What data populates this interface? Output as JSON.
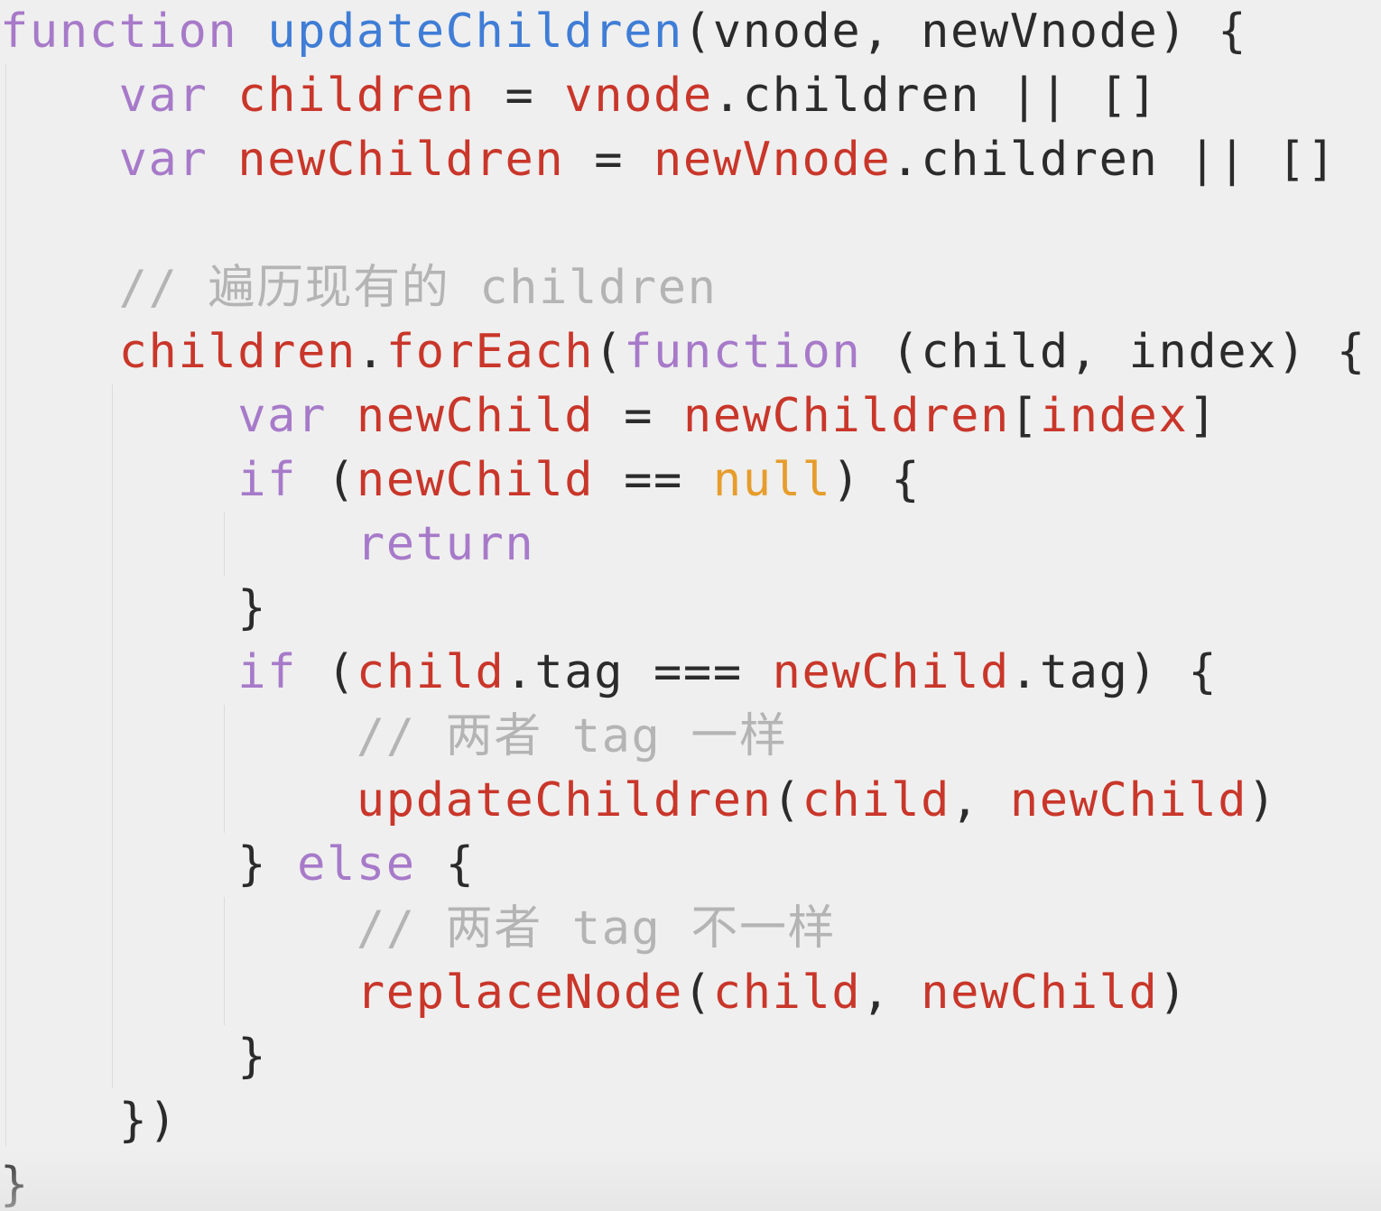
{
  "colors": {
    "keyword": "#a77ac9",
    "function_name": "#3f7dd6",
    "variable": "#c9362a",
    "plain": "#2b2b2b",
    "comment": "#b4b4b4",
    "literal": "#e69d2c",
    "background": "#efefef"
  },
  "code": {
    "lines": [
      {
        "tokens": [
          {
            "text": "function",
            "kind": "keyword"
          },
          {
            "text": " ",
            "kind": "plain"
          },
          {
            "text": "updateChildren",
            "kind": "function_name"
          },
          {
            "text": "(vnode, newVnode) {",
            "kind": "plain"
          }
        ]
      },
      {
        "tokens": [
          {
            "text": "    ",
            "kind": "plain"
          },
          {
            "text": "var",
            "kind": "keyword"
          },
          {
            "text": " ",
            "kind": "plain"
          },
          {
            "text": "children",
            "kind": "variable"
          },
          {
            "text": " = ",
            "kind": "plain"
          },
          {
            "text": "vnode",
            "kind": "variable"
          },
          {
            "text": ".children || []",
            "kind": "plain"
          }
        ]
      },
      {
        "tokens": [
          {
            "text": "    ",
            "kind": "plain"
          },
          {
            "text": "var",
            "kind": "keyword"
          },
          {
            "text": " ",
            "kind": "plain"
          },
          {
            "text": "newChildren",
            "kind": "variable"
          },
          {
            "text": " = ",
            "kind": "plain"
          },
          {
            "text": "newVnode",
            "kind": "variable"
          },
          {
            "text": ".children || []",
            "kind": "plain"
          }
        ]
      },
      {
        "tokens": []
      },
      {
        "tokens": [
          {
            "text": "    ",
            "kind": "plain"
          },
          {
            "text": "// 遍历现有的 children",
            "kind": "comment"
          }
        ]
      },
      {
        "tokens": [
          {
            "text": "    ",
            "kind": "plain"
          },
          {
            "text": "children",
            "kind": "variable"
          },
          {
            "text": ".",
            "kind": "plain"
          },
          {
            "text": "forEach",
            "kind": "variable"
          },
          {
            "text": "(",
            "kind": "plain"
          },
          {
            "text": "function",
            "kind": "keyword"
          },
          {
            "text": " (child, index) {",
            "kind": "plain"
          }
        ]
      },
      {
        "tokens": [
          {
            "text": "        ",
            "kind": "plain"
          },
          {
            "text": "var",
            "kind": "keyword"
          },
          {
            "text": " ",
            "kind": "plain"
          },
          {
            "text": "newChild",
            "kind": "variable"
          },
          {
            "text": " = ",
            "kind": "plain"
          },
          {
            "text": "newChildren",
            "kind": "variable"
          },
          {
            "text": "[",
            "kind": "plain"
          },
          {
            "text": "index",
            "kind": "variable"
          },
          {
            "text": "]",
            "kind": "plain"
          }
        ]
      },
      {
        "tokens": [
          {
            "text": "        ",
            "kind": "plain"
          },
          {
            "text": "if",
            "kind": "keyword"
          },
          {
            "text": " (",
            "kind": "plain"
          },
          {
            "text": "newChild",
            "kind": "variable"
          },
          {
            "text": " == ",
            "kind": "plain"
          },
          {
            "text": "null",
            "kind": "literal"
          },
          {
            "text": ") {",
            "kind": "plain"
          }
        ]
      },
      {
        "tokens": [
          {
            "text": "            ",
            "kind": "plain"
          },
          {
            "text": "return",
            "kind": "keyword"
          }
        ]
      },
      {
        "tokens": [
          {
            "text": "        }",
            "kind": "plain"
          }
        ]
      },
      {
        "tokens": [
          {
            "text": "        ",
            "kind": "plain"
          },
          {
            "text": "if",
            "kind": "keyword"
          },
          {
            "text": " (",
            "kind": "plain"
          },
          {
            "text": "child",
            "kind": "variable"
          },
          {
            "text": ".tag === ",
            "kind": "plain"
          },
          {
            "text": "newChild",
            "kind": "variable"
          },
          {
            "text": ".tag) {",
            "kind": "plain"
          }
        ]
      },
      {
        "tokens": [
          {
            "text": "            ",
            "kind": "plain"
          },
          {
            "text": "// 两者 tag 一样",
            "kind": "comment"
          }
        ]
      },
      {
        "tokens": [
          {
            "text": "            ",
            "kind": "plain"
          },
          {
            "text": "updateChildren",
            "kind": "variable"
          },
          {
            "text": "(",
            "kind": "plain"
          },
          {
            "text": "child",
            "kind": "variable"
          },
          {
            "text": ", ",
            "kind": "plain"
          },
          {
            "text": "newChild",
            "kind": "variable"
          },
          {
            "text": ")",
            "kind": "plain"
          }
        ]
      },
      {
        "tokens": [
          {
            "text": "        } ",
            "kind": "plain"
          },
          {
            "text": "else",
            "kind": "keyword"
          },
          {
            "text": " {",
            "kind": "plain"
          }
        ]
      },
      {
        "tokens": [
          {
            "text": "            ",
            "kind": "plain"
          },
          {
            "text": "// 两者 tag 不一样",
            "kind": "comment"
          }
        ]
      },
      {
        "tokens": [
          {
            "text": "            ",
            "kind": "plain"
          },
          {
            "text": "replaceNode",
            "kind": "variable"
          },
          {
            "text": "(",
            "kind": "plain"
          },
          {
            "text": "child",
            "kind": "variable"
          },
          {
            "text": ", ",
            "kind": "plain"
          },
          {
            "text": "newChild",
            "kind": "variable"
          },
          {
            "text": ")",
            "kind": "plain"
          }
        ]
      },
      {
        "tokens": [
          {
            "text": "        }",
            "kind": "plain"
          }
        ]
      },
      {
        "tokens": [
          {
            "text": "    })",
            "kind": "plain"
          }
        ]
      },
      {
        "tokens": [
          {
            "text": "}",
            "kind": "plain"
          }
        ]
      }
    ]
  }
}
